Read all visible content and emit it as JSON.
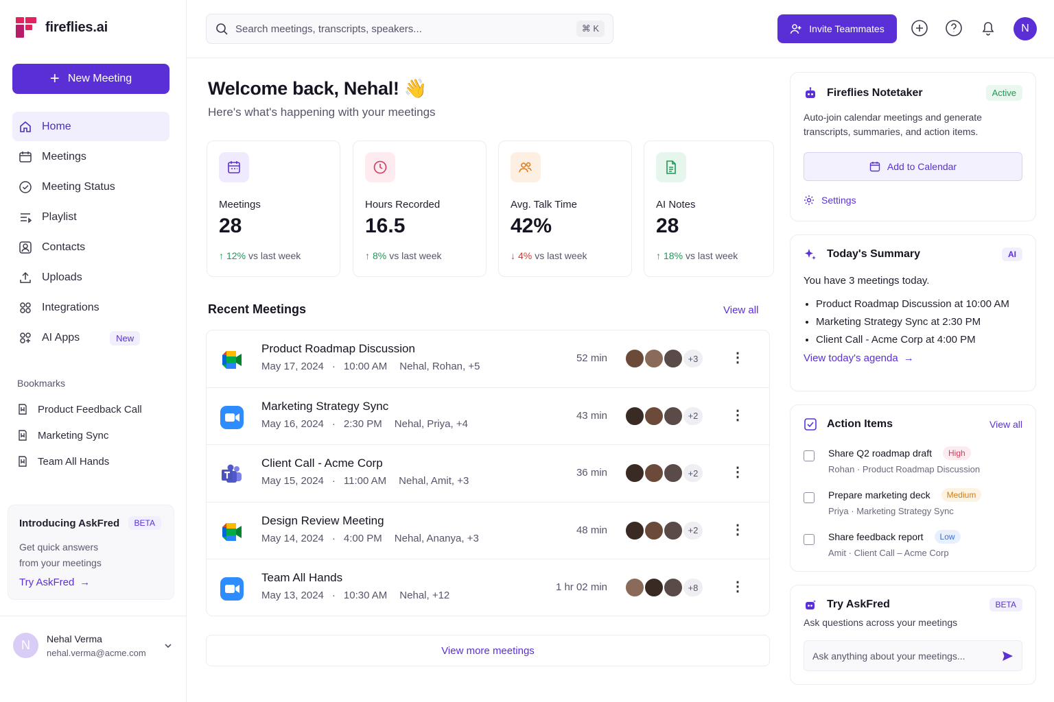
{
  "brand": {
    "name": "fireflies.ai"
  },
  "sidebar": {
    "new_meeting": "New Meeting",
    "items": [
      {
        "label": "Home",
        "icon": "home-icon"
      },
      {
        "label": "Meetings",
        "icon": "calendar-icon"
      },
      {
        "label": "Meeting Status",
        "icon": "status-icon"
      },
      {
        "label": "Playlist",
        "icon": "playlist-icon"
      },
      {
        "label": "Contacts",
        "icon": "contacts-icon"
      },
      {
        "label": "Uploads",
        "icon": "upload-icon"
      },
      {
        "label": "Integrations",
        "icon": "grid-icon"
      },
      {
        "label": "AI Apps",
        "icon": "apps-icon",
        "badge": "New"
      }
    ],
    "bookmarks_title": "Bookmarks",
    "bookmarks": [
      "Product Feedback Call",
      "Marketing Sync",
      "Team All Hands"
    ],
    "promo": {
      "title": "Introducing AskFred",
      "badge": "BETA",
      "desc1": "Get quick answers",
      "desc2": "from your meetings",
      "link": "Try AskFred"
    },
    "user": {
      "initial": "N",
      "name": "Nehal Verma",
      "email": "nehal.verma@acme.com"
    }
  },
  "topbar": {
    "search_placeholder": "Search meetings, transcripts, speakers...",
    "shortcut": "⌘ K",
    "invite": "Invite Teammates",
    "avatar": "N"
  },
  "main": {
    "welcome": "Welcome back, Nehal! 👋",
    "subtitle": "Here's what's happening with your meetings",
    "stats": [
      {
        "label": "Meetings",
        "value": "28",
        "delta": "12%",
        "trend": "up",
        "suffix": "vs last week"
      },
      {
        "label": "Hours Recorded",
        "value": "16.5",
        "delta": "8%",
        "trend": "up",
        "suffix": "vs last week"
      },
      {
        "label": "Avg. Talk Time",
        "value": "42%",
        "delta": "4%",
        "trend": "down",
        "suffix": "vs last week"
      },
      {
        "label": "AI Notes",
        "value": "28",
        "delta": "18%",
        "trend": "up",
        "suffix": "vs last week"
      }
    ],
    "recent_title": "Recent Meetings",
    "view_all": "View all",
    "meetings": [
      {
        "title": "Product Roadmap Discussion",
        "date": "May 17, 2024",
        "time": "10:00 AM",
        "people": "Nehal, Rohan,  +5",
        "duration": "52 min",
        "more": "+3",
        "app": "google-meet"
      },
      {
        "title": "Marketing Strategy Sync",
        "date": "May 16, 2024",
        "time": "2:30 PM",
        "people": "Nehal, Priya,  +4",
        "duration": "43 min",
        "more": "+2",
        "app": "zoom"
      },
      {
        "title": "Client Call - Acme Corp",
        "date": "May 15, 2024",
        "time": "11:00 AM",
        "people": "Nehal, Amit,  +3",
        "duration": "36 min",
        "more": "+2",
        "app": "teams"
      },
      {
        "title": "Design Review Meeting",
        "date": "May 14, 2024",
        "time": "4:00 PM",
        "people": "Nehal, Ananya,  +3",
        "duration": "48 min",
        "more": "+2",
        "app": "google-meet"
      },
      {
        "title": "Team All Hands",
        "date": "May 13, 2024",
        "time": "10:30 AM",
        "people": "Nehal,  +12",
        "duration": "1 hr 02 min",
        "more": "+8",
        "app": "zoom"
      }
    ],
    "view_more": "View more meetings"
  },
  "right": {
    "notetaker": {
      "title": "Fireflies Notetaker",
      "status": "Active",
      "desc": "Auto-join calendar meetings and generate transcripts, summaries, and action items.",
      "add_calendar": "Add to Calendar",
      "settings": "Settings"
    },
    "summary": {
      "title": "Today's Summary",
      "badge": "AI",
      "intro": "You have 3 meetings today.",
      "items": [
        "Product Roadmap Discussion at 10:00 AM",
        "Marketing Strategy Sync at 2:30 PM",
        "Client Call - Acme Corp at 4:00 PM"
      ],
      "link": "View today's agenda"
    },
    "actions": {
      "title": "Action Items",
      "view_all": "View all",
      "items": [
        {
          "title": "Share Q2 roadmap draft",
          "priority": "High",
          "owner": "Rohan",
          "meeting": "Product Roadmap Discussion"
        },
        {
          "title": "Prepare marketing deck",
          "priority": "Medium",
          "owner": "Priya",
          "meeting": "Marketing Strategy Sync"
        },
        {
          "title": "Share feedback report",
          "priority": "Low",
          "owner": "Amit",
          "meeting": "Client Call – Acme Corp"
        }
      ]
    },
    "askfred": {
      "title": "Try AskFred",
      "badge": "BETA",
      "desc": "Ask questions across your meetings",
      "placeholder": "Ask anything about your meetings..."
    }
  },
  "colors": {
    "accent": "#5a2fd6",
    "up": "#1b9a55",
    "down": "#d63a2f"
  }
}
